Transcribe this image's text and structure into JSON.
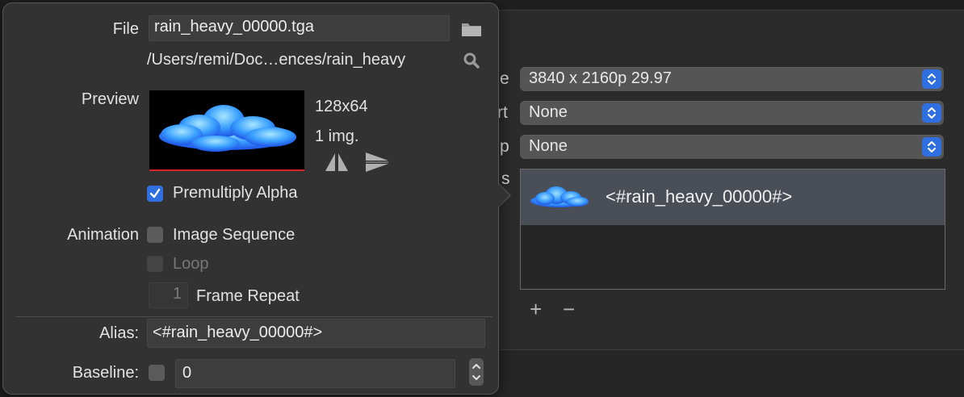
{
  "file": {
    "label": "File",
    "filename": "rain_heavy_00000.tga",
    "path": "/Users/remi/Doc…ences/rain_heavy"
  },
  "preview": {
    "label": "Preview",
    "size": "128x64",
    "count": "1 img."
  },
  "premultiply": {
    "label": "Premultiply Alpha",
    "checked": true
  },
  "animation": {
    "label": "Animation",
    "image_sequence": {
      "label": "Image Sequence",
      "checked": false
    },
    "loop": {
      "label": "Loop",
      "checked": false,
      "enabled": false
    },
    "frame_repeat": {
      "value": "1",
      "label": "Frame Repeat"
    }
  },
  "alias": {
    "label": "Alias:",
    "value": "<#rain_heavy_00000#>"
  },
  "baseline": {
    "label": "Baseline:",
    "checked": false,
    "value": "0"
  },
  "background": {
    "fragments": [
      "e",
      "rt",
      "p",
      "s"
    ],
    "selects": [
      {
        "value": "3840 x 2160p 29.97"
      },
      {
        "value": "None"
      },
      {
        "value": "None"
      }
    ],
    "media_item": {
      "label": "<#rain_heavy_00000#>"
    },
    "add": "+",
    "remove": "−"
  },
  "colors": {
    "accent": "#2f6fe0",
    "cloud": "#3aa4ff"
  },
  "icons": {
    "folder": "folder-icon",
    "search": "magnifier-icon",
    "flip_h": "flip-horizontal-icon",
    "flip_v": "flip-vertical-icon"
  }
}
